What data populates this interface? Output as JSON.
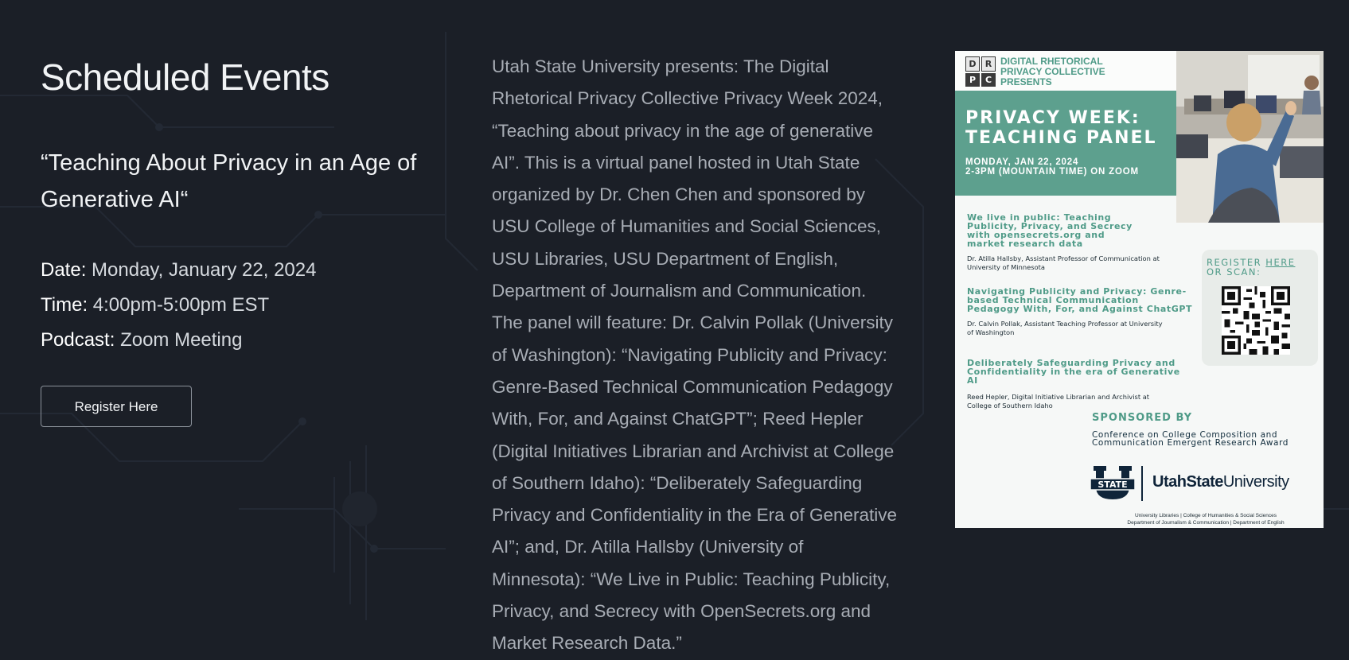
{
  "page": {
    "title": "Scheduled Events",
    "event_title": "“Teaching About Privacy in an Age of Generative AI“",
    "date_label": "Date:",
    "date_value": "Monday, January 22, 2024",
    "time_label": "Time:",
    "time_value": "4:00pm-5:00pm EST",
    "podcast_label": "Podcast:",
    "podcast_value": "Zoom Meeting",
    "register_label": "Register Here"
  },
  "description": "Utah State University presents: The Digital Rhetorical Privacy Collective Privacy Week 2024, “Teaching about privacy in the age of generative AI”. This is a virtual panel hosted in Utah State organized by Dr. Chen Chen and sponsored by USU College of Humanities and Social Sciences, USU Libraries, USU Department of English, Department of Journalism and Communication. The panel will feature: Dr. Calvin Pollak (University of Washington): “Navigating Publicity and Privacy: Genre-Based Technical Communication Pedagogy With, For, and Against ChatGPT”; Reed Hepler (Digital Initiatives Librarian and Archivist at College of Southern Idaho): “Deliberately Safeguarding Privacy and Confidentiality in the Era of Generative AI”; and, Dr. Atilla Hallsby (University of Minnesota): “We Live in Public: Teaching Publicity, Privacy, and Secrecy with OpenSecrets.org and Market Research Data.”",
  "poster": {
    "logo_letters": [
      "D",
      "R",
      "P",
      "C"
    ],
    "org_line1": "DIGITAL RHETORICAL",
    "org_line2": "PRIVACY COLLECTIVE",
    "org_line3": "PRESENTS",
    "title_line1": "PRIVACY WEEK:",
    "title_line2": "TEACHING PANEL",
    "date_line1": "MONDAY, JAN 22, 2024",
    "date_line2": "2-3PM (MOUNTAIN TIME) ON ZOOM",
    "talks": [
      {
        "title": "We live in public: Teaching Publicity, Privacy, and Secrecy with opensecrets.org and market research data",
        "speaker": "Dr. Atilla Hallsby, Assistant Professor of Communication at University of Minnesota"
      },
      {
        "title": "Navigating Publicity and Privacy: Genre-based Technical Communication Pedagogy With, For, and Against ChatGPT",
        "speaker": "Dr. Calvin Pollak, Assistant Teaching Professor at University of Washington"
      },
      {
        "title": "Deliberately Safeguarding Privacy and Confidentiality in the era of Generative AI",
        "speaker": "Reed Hepler, Digital Initiative Librarian and Archivist at College of Southern Idaho"
      }
    ],
    "register_prefix": "REGISTER",
    "register_link": "HERE",
    "register_suffix": "OR SCAN:",
    "sponsored_by": "SPONSORED BY",
    "sponsor_line1": "Conference on College Composition and",
    "sponsor_line2": "Communication Emergent Research Award",
    "usu_logo_word": "STATE",
    "usu_name_bold": "UtahState",
    "usu_name_rest": "University",
    "footer_line1": "University Libraries | College of Humanities & Social Sciences",
    "footer_line2": "Department of Journalism & Communication | Department of English"
  },
  "colors": {
    "background": "#1b1f27",
    "teal": "#5da08e",
    "muted_text": "#a8adb5"
  }
}
